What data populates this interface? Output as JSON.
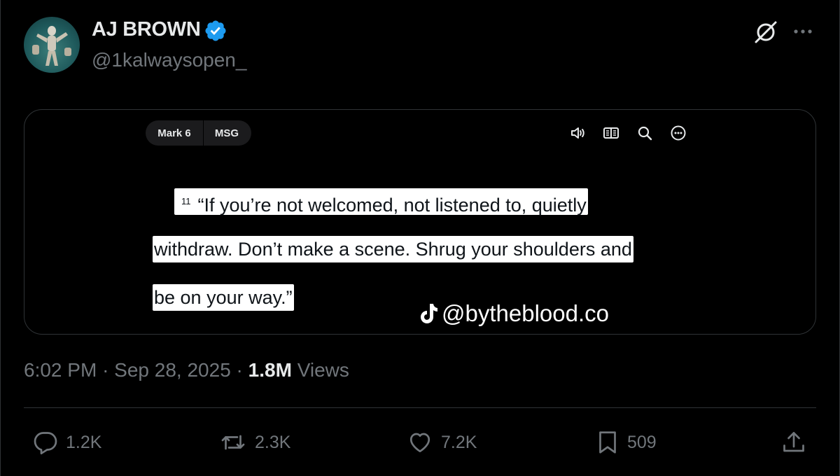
{
  "author": {
    "display_name": "AJ BROWN",
    "handle": "@1kalwaysopen_",
    "verified": true,
    "verified_color": "#1d9bf0",
    "avatar_icon": "statue-avatar"
  },
  "header_actions": {
    "grok_icon": "grok-icon",
    "more_icon": "more-horizontal-icon"
  },
  "media": {
    "tabs": {
      "book": "Mark 6",
      "version": "MSG"
    },
    "toolbar_icons": [
      "speaker-icon",
      "reader-icon",
      "search-icon",
      "more-circle-icon"
    ],
    "verse_number": "11",
    "lines": [
      "“If you’re not welcomed, not listened to, quietly",
      "withdraw. Don’t make a scene. Shrug your shoulders and",
      "be on your way.”"
    ],
    "watermark": "@bytheblood.co",
    "watermark_icon": "tiktok-icon"
  },
  "meta": {
    "time": "6:02 PM",
    "separator": "·",
    "date": "Sep 28, 2025",
    "views_count": "1.8M",
    "views_label": "Views"
  },
  "actions": {
    "replies": "1.2K",
    "reposts": "2.3K",
    "likes": "7.2K",
    "bookmarks": "509"
  },
  "colors": {
    "background": "#000000",
    "text_primary": "#e7e9ea",
    "text_secondary": "#71767b",
    "border": "#2f3336"
  }
}
